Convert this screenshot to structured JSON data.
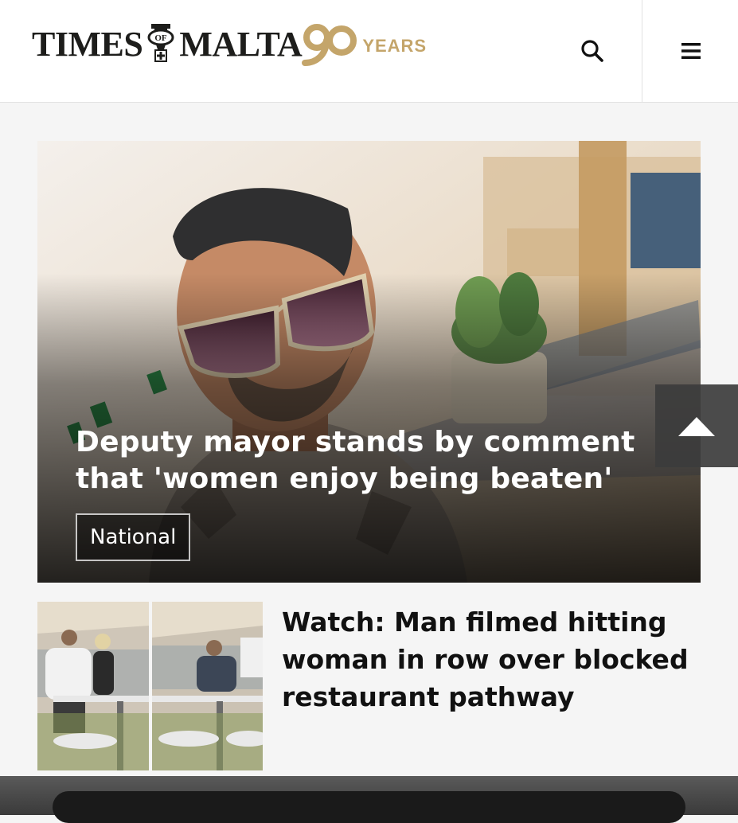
{
  "header": {
    "logo": {
      "word1": "TIMES",
      "crest_text": "OF",
      "word2": "MALTA",
      "anniversary_number": "90",
      "anniversary_label": "YEARS"
    },
    "search_icon": "search-icon",
    "menu_icon": "hamburger-menu-icon"
  },
  "hero": {
    "title": "Deputy mayor stands by comment that 'women enjoy being beaten'",
    "category": "National"
  },
  "scroll_top_icon": "arrow-up-icon",
  "articles": [
    {
      "title": "Watch: Man filmed hitting woman in row over blocked restaurant pathway"
    }
  ],
  "colors": {
    "brand_dark": "#1d1d1b",
    "brand_gold": "#c4a56a",
    "background": "#f5f5f5"
  }
}
